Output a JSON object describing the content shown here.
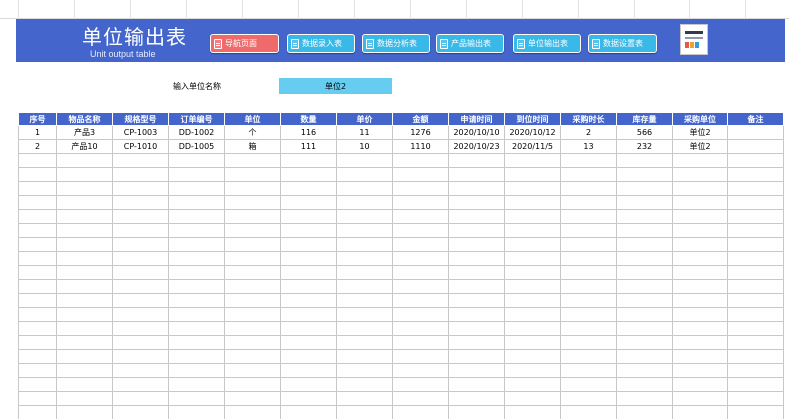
{
  "header": {
    "title_cn": "单位输出表",
    "title_en": "Unit output table"
  },
  "nav": [
    {
      "label": "导航页面",
      "active": true
    },
    {
      "label": "数据录入表",
      "active": false
    },
    {
      "label": "数据分析表",
      "active": false
    },
    {
      "label": "产品输出表",
      "active": false
    },
    {
      "label": "单位输出表",
      "active": false
    },
    {
      "label": "数据设置表",
      "active": false
    }
  ],
  "query": {
    "label": "输入单位名称",
    "value": "单位2"
  },
  "table": {
    "columns": [
      "序号",
      "物品名称",
      "规格型号",
      "订单编号",
      "单位",
      "数量",
      "单价",
      "金额",
      "申请时间",
      "到位时间",
      "采购时长",
      "库存量",
      "采购单位",
      "备注"
    ],
    "rows": [
      [
        "1",
        "产品3",
        "CP-1003",
        "DD-1002",
        "个",
        "116",
        "11",
        "1276",
        "2020/10/10",
        "2020/10/12",
        "2",
        "566",
        "单位2",
        ""
      ],
      [
        "2",
        "产品10",
        "CP-1010",
        "DD-1005",
        "箱",
        "111",
        "10",
        "1110",
        "2020/10/23",
        "2020/11/5",
        "13",
        "232",
        "单位2",
        ""
      ]
    ],
    "empty_rows": 20
  },
  "colors": {
    "header_bg": "#4466cc",
    "active_nav": "#ef6b6b",
    "nav": "#38b9e8",
    "input_bg": "#66ccf0"
  }
}
